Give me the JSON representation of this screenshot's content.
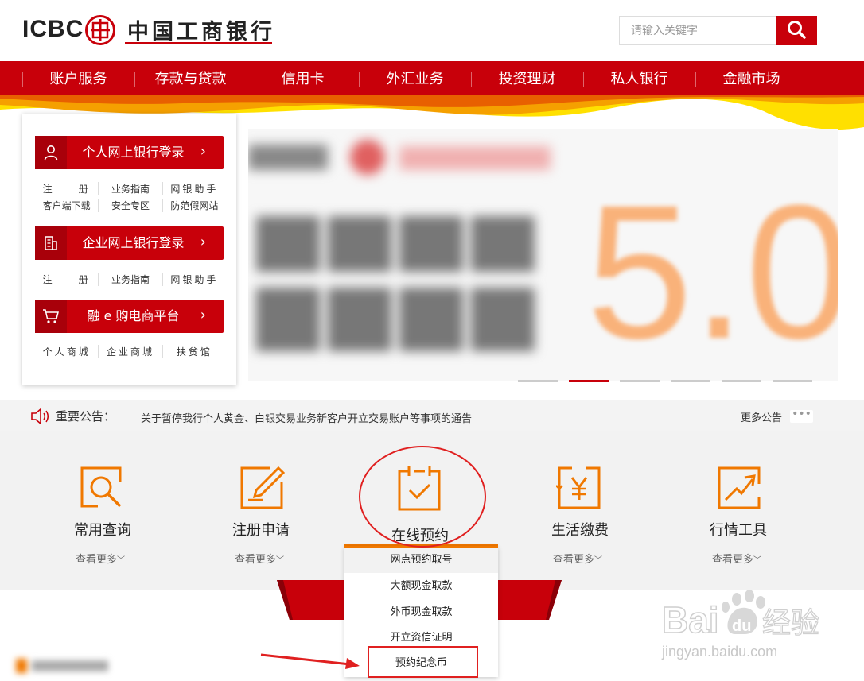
{
  "header": {
    "logo_en": "ICBC",
    "logo_cn": "中国工商银行",
    "search_placeholder": "请输入关键字"
  },
  "nav": [
    "账户服务",
    "存款与贷款",
    "信用卡",
    "外汇业务",
    "投资理财",
    "私人银行",
    "金融市场"
  ],
  "banner": {
    "big_text": "5.0",
    "dots": 6,
    "active_dot": 1
  },
  "login": {
    "personal": {
      "label": "个人网上银行登录",
      "links_row1": [
        "注　　册",
        "业务指南",
        "网银助手"
      ],
      "links_row2": [
        "客户端下载",
        "安全专区",
        "防范假网站"
      ]
    },
    "corporate": {
      "label": "企业网上银行登录",
      "links_row1": [
        "注　　册",
        "业务指南",
        "网银助手"
      ]
    },
    "ecommerce": {
      "label": "融 e 购电商平台",
      "links_row1": [
        "个人商城",
        "企业商城",
        "扶贫馆"
      ]
    },
    "arrow": "›"
  },
  "notice": {
    "title": "重要公告：",
    "text": "关于暂停我行个人黄金、白银交易业务新客户开立交易账户等事项的通告",
    "more": "更多公告",
    "dots": "•••"
  },
  "services": [
    {
      "title": "常用查询",
      "more": "查看更多"
    },
    {
      "title": "注册申请",
      "more": "查看更多"
    },
    {
      "title": "在线预约",
      "more": ""
    },
    {
      "title": "生活缴费",
      "more": "查看更多"
    },
    {
      "title": "行情工具",
      "more": "查看更多"
    }
  ],
  "dropdown": [
    "网点预约取号",
    "大额现金取款",
    "外币现金取款",
    "开立资信证明",
    "预约纪念币"
  ],
  "watermark": {
    "brand": "Bai",
    "du": "du",
    "cn": "经验",
    "url": "jingyan.baidu.com"
  },
  "colors": {
    "brand_red": "#c8000a",
    "accent_orange": "#f07800",
    "annotation_red": "#e02020"
  }
}
